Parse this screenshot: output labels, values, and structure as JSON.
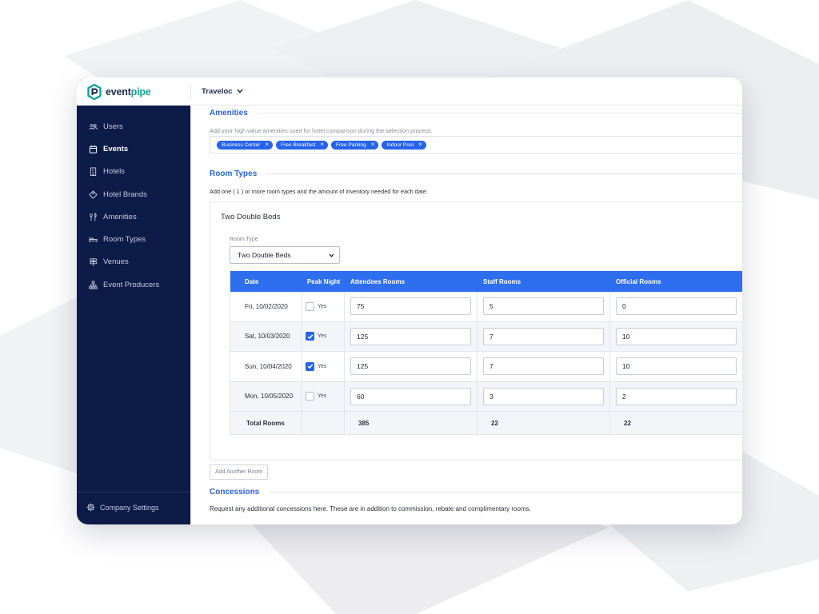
{
  "brand": {
    "name_part1": "event",
    "name_part2": "pipe",
    "accent_color": "#14a39a"
  },
  "topbar": {
    "account": "Traveloc"
  },
  "sidebar": {
    "items": [
      {
        "label": "Users",
        "icon": "users-icon"
      },
      {
        "label": "Events",
        "icon": "calendar-icon",
        "active": true
      },
      {
        "label": "Hotels",
        "icon": "building-icon"
      },
      {
        "label": "Hotel Brands",
        "icon": "tag-icon"
      },
      {
        "label": "Amenities",
        "icon": "utensils-icon"
      },
      {
        "label": "Room Types",
        "icon": "bed-icon"
      },
      {
        "label": "Venues",
        "icon": "signpost-icon"
      },
      {
        "label": "Event Producers",
        "icon": "sitemap-icon"
      }
    ],
    "footer": {
      "label": "Company Settings",
      "icon": "gear-icon"
    }
  },
  "amenities": {
    "title": "Amenities",
    "help": "Add your high value amenities used for hotel comparison during the selection process.",
    "tags": [
      "Business Center",
      "Free Breakfast",
      "Free Parking",
      "Indoor Pool"
    ]
  },
  "room_types": {
    "title": "Room Types",
    "help": "Add one ( 1 ) or more room types and the amount of inventory needed for each date.",
    "card_title": "Two Double Beds",
    "select_label": "Room Type",
    "select_value": "Two Double Beds",
    "columns": [
      "Date",
      "Peak Night",
      "Attendees Rooms",
      "Staff Rooms",
      "Official Rooms"
    ],
    "rows": [
      {
        "date": "Fri, 10/02/2020",
        "peak": false,
        "peak_label": "Yes",
        "attendees": "75",
        "staff": "5",
        "official": "0"
      },
      {
        "date": "Sat, 10/03/2020",
        "peak": true,
        "peak_label": "Yes",
        "attendees": "125",
        "staff": "7",
        "official": "10"
      },
      {
        "date": "Sun, 10/04/2020",
        "peak": true,
        "peak_label": "Yes",
        "attendees": "125",
        "staff": "7",
        "official": "10"
      },
      {
        "date": "Mon, 10/05/2020",
        "peak": false,
        "peak_label": "Yes",
        "attendees": "60",
        "staff": "3",
        "official": "2"
      }
    ],
    "totals": {
      "label": "Total Rooms",
      "attendees": "385",
      "staff": "22",
      "official": "22"
    },
    "add_button": "Add Another Room"
  },
  "concessions": {
    "title": "Concessions",
    "help": "Request any additional concessions here. These are in addition to commission, rebate and complimentary rooms."
  },
  "colors": {
    "sidebar": "#0d1b48",
    "accent_blue": "#2563eb",
    "table_header": "#2d6fef"
  }
}
